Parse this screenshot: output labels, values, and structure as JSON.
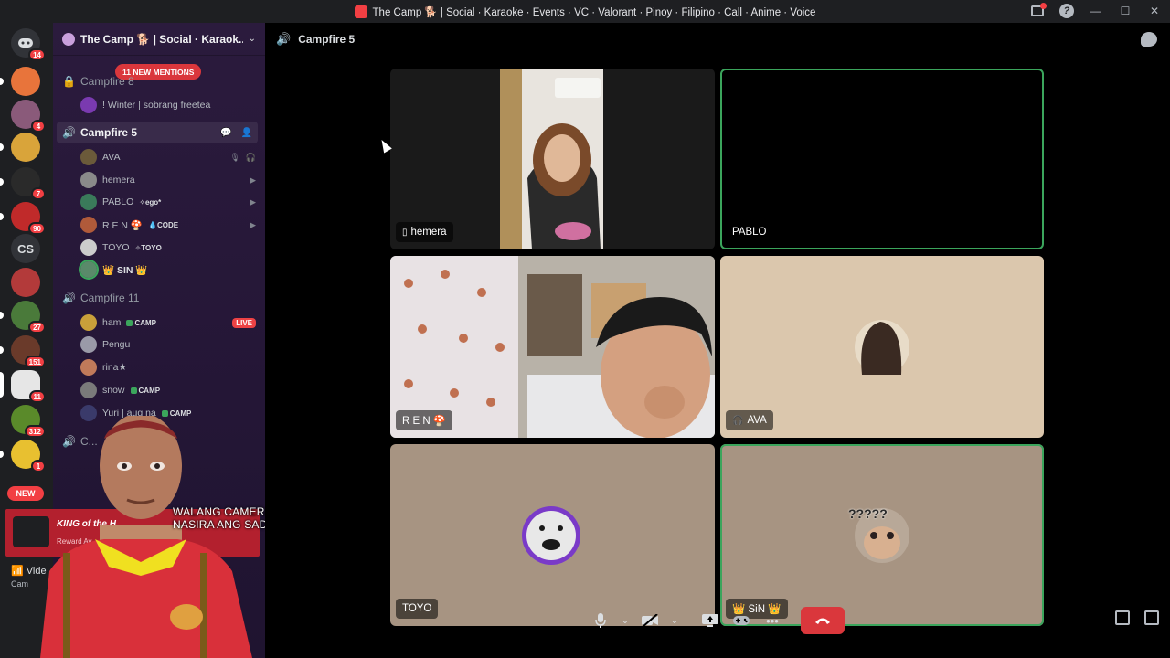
{
  "window": {
    "title": "The Camp 🐕 | Social · Karaoke · Events · VC · Valorant · Pinoy · Filipino · Call · Anime · Voice"
  },
  "rail": {
    "home_badge": "14",
    "servers": [
      {
        "badge": "",
        "color": "#e8743b"
      },
      {
        "badge": "4",
        "color": "#8a5a7a"
      },
      {
        "badge": "",
        "color": "#d9a43a"
      },
      {
        "badge": "7",
        "color": "#2a2a2a"
      },
      {
        "badge": "90",
        "color": "#c02a2a"
      },
      {
        "label": "CS"
      },
      {
        "badge": "",
        "color": "#b33a3a"
      },
      {
        "badge": "27",
        "color": "#4a7a3a"
      },
      {
        "badge": "151",
        "color": "#6a3a2a"
      },
      {
        "badge": "11",
        "color": "#e6e6e6"
      },
      {
        "badge": "312",
        "color": "#5a8a2a"
      },
      {
        "badge": "1",
        "color": "#e8c030"
      }
    ],
    "new_label": "NEW"
  },
  "sidebar": {
    "server_name": "The Camp 🐕 | Social · Karaok...",
    "mentions": "11 NEW MENTIONS",
    "channels": {
      "campfire8": "Campfire 8",
      "campfire5": "Campfire 5",
      "campfire11": "Campfire 11",
      "collapsed": "C..."
    },
    "campfire8_users": [
      {
        "name": "! Winter | sobrang freetea"
      }
    ],
    "campfire5_users": [
      {
        "name": "AVA",
        "tag": ""
      },
      {
        "name": "hemera",
        "tag": ""
      },
      {
        "name": "PABLO",
        "tag": "✧ego*"
      },
      {
        "name": "R E N 🍄",
        "tag": "💧CODE"
      },
      {
        "name": "TOYO",
        "tag": "✧TOYO"
      },
      {
        "name": "👑 SIN 👑",
        "tag": ""
      }
    ],
    "campfire11_users": [
      {
        "name": "ham",
        "tag": "CAMP",
        "live": "LIVE"
      },
      {
        "name": "Pengu",
        "tag": ""
      },
      {
        "name": "rina★",
        "tag": ""
      },
      {
        "name": "snow",
        "tag": "CAMP"
      },
      {
        "name": "Yuri | aug na",
        "tag": "CAMP"
      }
    ]
  },
  "overlay": {
    "text_line1": "WALANG CAMERA",
    "text_line2": "NASIRA ANG SAD",
    "card_title": "KING of the H",
    "card_sub": "Reward Av",
    "video_label": "Vide",
    "video_sub": "Cam"
  },
  "call": {
    "channel": "Campfire 5",
    "tiles": [
      {
        "name": "hemera",
        "speaking": false
      },
      {
        "name": "PABLO",
        "speaking": true
      },
      {
        "name": "R E N 🍄",
        "speaking": false
      },
      {
        "name": "AVA",
        "speaking": false
      },
      {
        "name": "TOYO",
        "speaking": false
      },
      {
        "name": "👑 SiN 👑",
        "speaking": true
      }
    ],
    "sin_bubble": "?????"
  },
  "colors": {
    "accent_green": "#3ba55c",
    "danger_red": "#da373c",
    "sidebar_purple": "#2b1b3d"
  }
}
